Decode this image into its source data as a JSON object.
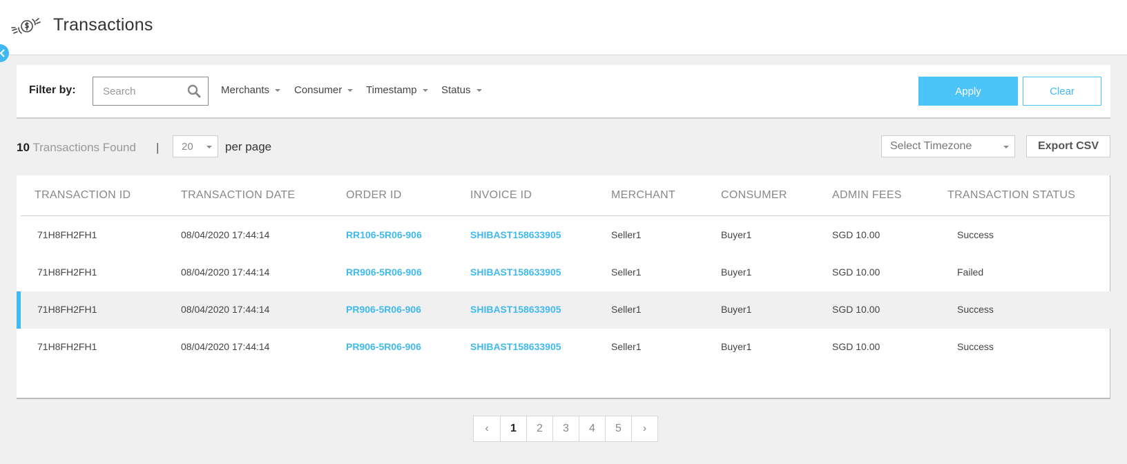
{
  "header": {
    "title": "Transactions",
    "logo_icon": "money-exchange-icon"
  },
  "filter": {
    "label": "Filter by:",
    "search_placeholder": "Search",
    "dropdowns": [
      "Merchants",
      "Consumer",
      "Timestamp",
      "Status"
    ],
    "apply_label": "Apply",
    "clear_label": "Clear"
  },
  "results": {
    "count": "10",
    "found_label": "Transactions Found",
    "separator": "|",
    "per_page_value": "20",
    "per_page_label": "per page",
    "timezone_placeholder": "Select Timezone",
    "export_label": "Export CSV"
  },
  "table": {
    "columns": [
      "TRANSACTION ID",
      "TRANSACTION DATE",
      "ORDER ID",
      "INVOICE ID",
      "MERCHANT",
      "CONSUMER",
      "ADMIN FEES",
      "TRANSACTION STATUS"
    ],
    "rows": [
      {
        "id": "71H8FH2FH1",
        "date": "08/04/2020 17:44:14",
        "order": "RR106-5R06-906",
        "invoice": "SHIBAST158633905",
        "merchant": "Seller1",
        "consumer": "Buyer1",
        "fees": "SGD 10.00",
        "status": "Success"
      },
      {
        "id": "71H8FH2FH1",
        "date": "08/04/2020 17:44:14",
        "order": "RR906-5R06-906",
        "invoice": "SHIBAST158633905",
        "merchant": "Seller1",
        "consumer": "Buyer1",
        "fees": "SGD 10.00",
        "status": "Failed"
      },
      {
        "id": "71H8FH2FH1",
        "date": "08/04/2020 17:44:14",
        "order": "PR906-5R06-906",
        "invoice": "SHIBAST158633905",
        "merchant": "Seller1",
        "consumer": "Buyer1",
        "fees": "SGD 10.00",
        "status": "Success"
      },
      {
        "id": "71H8FH2FH1",
        "date": "08/04/2020 17:44:14",
        "order": "PR906-5R06-906",
        "invoice": "SHIBAST158633905",
        "merchant": "Seller1",
        "consumer": "Buyer1",
        "fees": "SGD 10.00",
        "status": "Success"
      }
    ],
    "highlighted_row": 2
  },
  "pagination": {
    "prev": "‹",
    "pages": [
      "1",
      "2",
      "3",
      "4",
      "5"
    ],
    "next": "›",
    "current": "1"
  },
  "colors": {
    "accent": "#3fb9f0",
    "apply_bg": "#4cc4f7",
    "page_bg": "#f0f0f0"
  }
}
